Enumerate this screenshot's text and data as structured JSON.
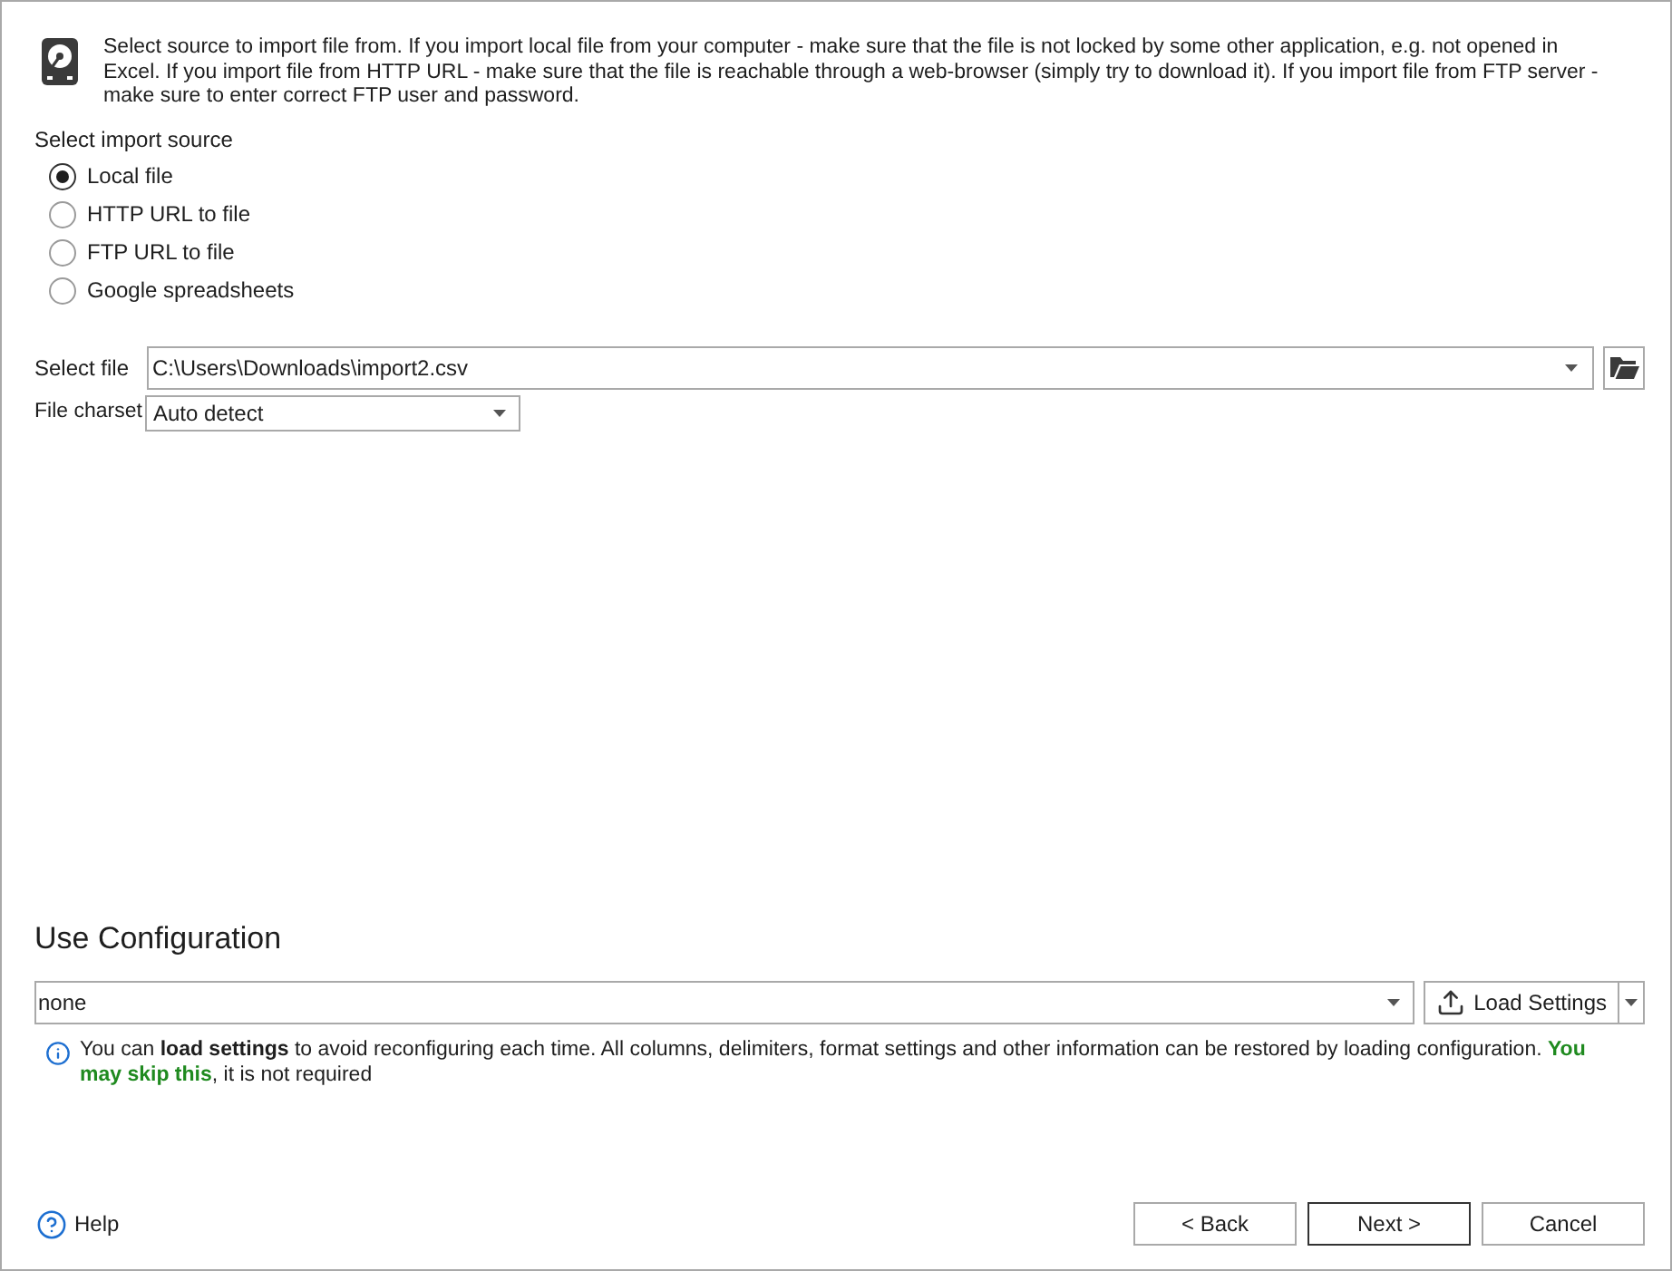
{
  "header": {
    "text": "Select source to import file from. If you import local file from your computer - make sure that the file is not locked by some other application, e.g. not opened in Excel. If you import file from HTTP URL - make sure that the file is reachable through a web-browser (simply try to download it). If you import file from FTP server - make sure to enter correct FTP user and password."
  },
  "import_source": {
    "label": "Select import source",
    "options": [
      {
        "label": "Local file",
        "selected": true
      },
      {
        "label": "HTTP URL to file",
        "selected": false
      },
      {
        "label": "FTP URL to file",
        "selected": false
      },
      {
        "label": "Google spreadsheets",
        "selected": false
      }
    ]
  },
  "file": {
    "label": "Select file",
    "value": "C:\\Users\\Downloads\\import2.csv"
  },
  "charset": {
    "label": "File charset",
    "value": "Auto detect"
  },
  "configuration": {
    "title": "Use Configuration",
    "value": "none",
    "load_button": "Load Settings",
    "info": [
      {
        "text": "You can **load settings** to avoid reconfiguring each time. All columns, delimiters, format settings and other information can be restored by loading configuration. ",
        "kind": "plain"
      },
      {
        "text": "You may skip this",
        "kind": "highlight"
      },
      {
        "text": ", it is not required",
        "kind": "plain"
      }
    ]
  },
  "footer": {
    "help": "Help",
    "buttons": [
      {
        "label": "< Back",
        "kind": "normal"
      },
      {
        "label": "Next >",
        "kind": "default"
      },
      {
        "label": "Cancel",
        "kind": "normal"
      }
    ]
  }
}
